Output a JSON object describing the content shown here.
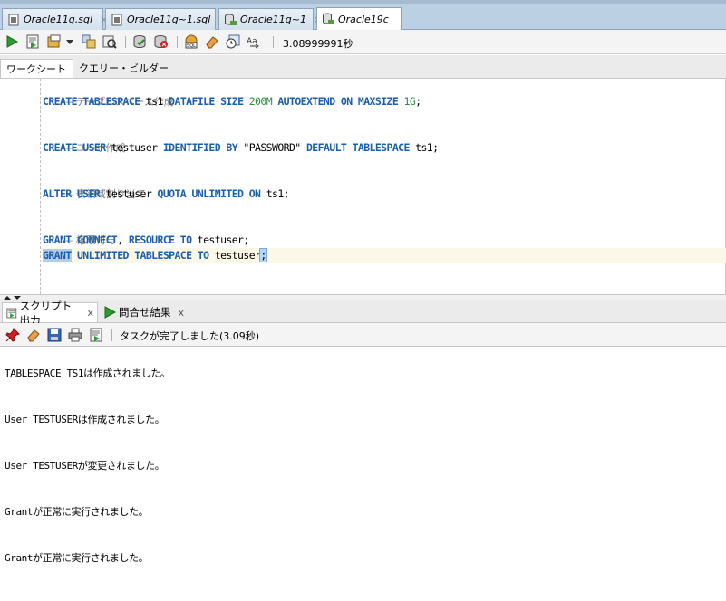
{
  "doc_tabs": [
    {
      "label": "Oracle11g.sql",
      "icon": "sql-file-icon",
      "close": "×"
    },
    {
      "label": "Oracle11g~1.sql",
      "icon": "sql-file-icon",
      "close": "×"
    },
    {
      "label": "Oracle11g~1",
      "icon": "db-connection-icon",
      "close": "×"
    },
    {
      "label": "Oracle19c",
      "icon": "db-connection-icon",
      "active": true
    }
  ],
  "toolbar": {
    "execution_time": "3.08999991秒",
    "icons": [
      "run-statement-icon",
      "run-script-icon",
      "commit-icon",
      "dropdown-arrow-icon",
      "explain-plan-icon",
      "autotrace-icon",
      "commit-transaction-icon",
      "rollback-icon",
      "sql-tuning-icon",
      "clear-eraser-icon",
      "history-icon",
      "format-case-icon"
    ]
  },
  "sub_tabs": {
    "worksheet": "ワークシート",
    "query_builder": "クエリー・ビルダー"
  },
  "editor": {
    "comment1": "-- テーブルスペース作成",
    "line1": {
      "kw1": "CREATE",
      "kw2": "TABLESPACE",
      "name": "ts1",
      "kw3": "DATAFILE",
      "kw4": "SIZE",
      "size": "200M",
      "kw5": "AUTOEXTEND",
      "kw6": "ON",
      "kw7": "MAXSIZE",
      "max": "1G",
      "end": ";"
    },
    "comment2": "-- ユーザ作成",
    "line2": {
      "kw1": "CREATE",
      "kw2": "USER",
      "name": "testuser",
      "kw3": "IDENTIFIED",
      "kw4": "BY",
      "pwd": "\"PASSWORD\"",
      "kw5": "DEFAULT",
      "kw6": "TABLESPACE",
      "ts": "ts1;"
    },
    "comment3": "-- 表領域割り当て",
    "line3": {
      "kw1": "ALTER",
      "kw2": "USER",
      "name": "testuser",
      "kw3": "QUOTA",
      "kw4": "UNLIMITED",
      "kw5": "ON",
      "ts": "ts1;"
    },
    "comment4": "-- 権限付与",
    "line4": {
      "kw1": "GRANT",
      "kw2": "CONNECT",
      "comma": ",",
      "kw3": "RESOURCE",
      "kw4": "TO",
      "name": "testuser;"
    },
    "line5": {
      "kw1": "GRANT",
      "kw2": "UNLIMITED",
      "kw3": "TABLESPACE",
      "kw4": "TO",
      "name": "testuser",
      "end": ";"
    }
  },
  "output_tabs": [
    {
      "label": "スクリプト出力",
      "icon": "script-output-icon",
      "close": "x"
    },
    {
      "label": "問合せ結果",
      "icon": "query-result-icon",
      "close": "x"
    }
  ],
  "output_toolbar": {
    "status": "タスクが完了しました(3.09秒)",
    "icons": [
      "pin-icon",
      "clear-eraser-icon",
      "save-icon",
      "print-icon",
      "open-file-icon"
    ]
  },
  "console": [
    "TABLESPACE TS1は作成されました。",
    "User TESTUSERは作成されました。",
    "User TESTUSERが変更されました。",
    "Grantが正常に実行されました。",
    "Grantが正常に実行されました。"
  ]
}
